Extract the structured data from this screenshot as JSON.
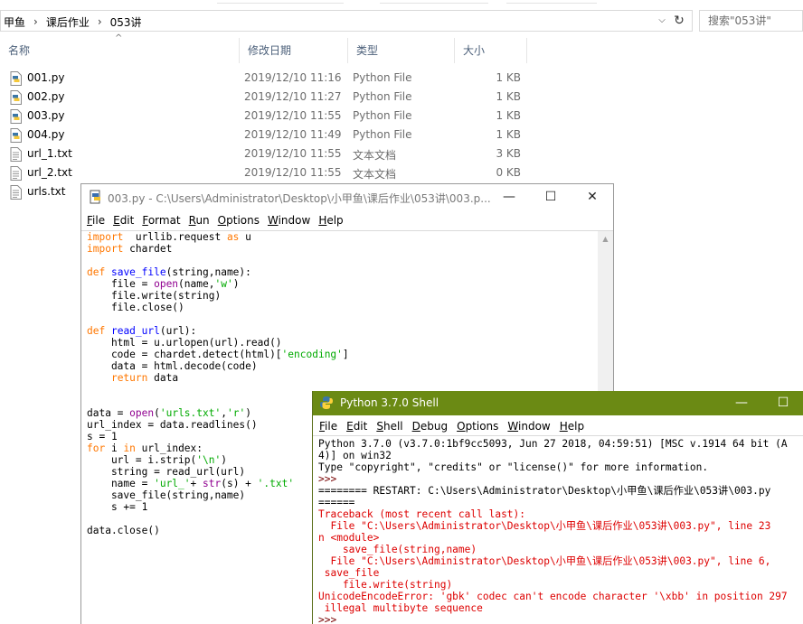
{
  "explorer": {
    "breadcrumbs": [
      "甲鱼",
      "课后作业",
      "053讲"
    ],
    "search_placeholder": "搜索\"053讲\"",
    "columns": {
      "name": "名称",
      "date": "修改日期",
      "type": "类型",
      "size": "大小"
    },
    "files": [
      {
        "name": "001.py",
        "date": "2019/12/10 11:16",
        "type": "Python File",
        "size": "1 KB",
        "icon": "python-file-icon"
      },
      {
        "name": "002.py",
        "date": "2019/12/10 11:27",
        "type": "Python File",
        "size": "1 KB",
        "icon": "python-file-icon"
      },
      {
        "name": "003.py",
        "date": "2019/12/10 11:55",
        "type": "Python File",
        "size": "1 KB",
        "icon": "python-file-icon"
      },
      {
        "name": "004.py",
        "date": "2019/12/10 11:49",
        "type": "Python File",
        "size": "1 KB",
        "icon": "python-file-icon"
      },
      {
        "name": "url_1.txt",
        "date": "2019/12/10 11:55",
        "type": "文本文档",
        "size": "3 KB",
        "icon": "text-file-icon"
      },
      {
        "name": "url_2.txt",
        "date": "2019/12/10 11:55",
        "type": "文本文档",
        "size": "0 KB",
        "icon": "text-file-icon"
      },
      {
        "name": "urls.txt",
        "date": "",
        "type": "",
        "size": "",
        "icon": "text-file-icon"
      }
    ]
  },
  "editor": {
    "title": "003.py - C:\\Users\\Administrator\\Desktop\\小甲鱼\\课后作业\\053讲\\003.p...",
    "menu": [
      "File",
      "Edit",
      "Format",
      "Run",
      "Options",
      "Window",
      "Help"
    ],
    "code_lines": [
      [
        [
          "kw",
          "import"
        ],
        [
          "",
          "  urllib.request "
        ],
        [
          "kw",
          "as"
        ],
        [
          "",
          " u"
        ]
      ],
      [
        [
          "kw",
          "import"
        ],
        [
          "",
          " chardet"
        ]
      ],
      [
        [
          "",
          ""
        ]
      ],
      [
        [
          "kw",
          "def"
        ],
        [
          "",
          " "
        ],
        [
          "df",
          "save_file"
        ],
        [
          "",
          "(string,name):"
        ]
      ],
      [
        [
          "",
          "    file = "
        ],
        [
          "bi",
          "open"
        ],
        [
          "",
          "(name,"
        ],
        [
          "st",
          "'w'"
        ],
        [
          "",
          ")"
        ]
      ],
      [
        [
          "",
          "    file.write(string)"
        ]
      ],
      [
        [
          "",
          "    file.close()"
        ]
      ],
      [
        [
          "",
          ""
        ]
      ],
      [
        [
          "kw",
          "def"
        ],
        [
          "",
          " "
        ],
        [
          "df",
          "read_url"
        ],
        [
          "",
          "(url):"
        ]
      ],
      [
        [
          "",
          "    html = u.urlopen(url).read()"
        ]
      ],
      [
        [
          "",
          "    code = chardet.detect(html)["
        ],
        [
          "st",
          "'encoding'"
        ],
        [
          "",
          "]"
        ]
      ],
      [
        [
          "",
          "    data = html.decode(code)"
        ]
      ],
      [
        [
          "",
          "    "
        ],
        [
          "kw",
          "return"
        ],
        [
          "",
          " data"
        ]
      ],
      [
        [
          "",
          ""
        ]
      ],
      [
        [
          "",
          ""
        ]
      ],
      [
        [
          "",
          "data = "
        ],
        [
          "bi",
          "open"
        ],
        [
          "",
          "("
        ],
        [
          "st",
          "'urls.txt'"
        ],
        [
          "",
          ","
        ],
        [
          "st",
          "'r'"
        ],
        [
          "",
          ")"
        ]
      ],
      [
        [
          "",
          "url_index = data.readlines()"
        ]
      ],
      [
        [
          "",
          "s = 1"
        ]
      ],
      [
        [
          "kw",
          "for"
        ],
        [
          "",
          " i "
        ],
        [
          "kw",
          "in"
        ],
        [
          "",
          " url_index:"
        ]
      ],
      [
        [
          "",
          "    url = i.strip("
        ],
        [
          "st",
          "'\\n'"
        ],
        [
          "",
          ")"
        ]
      ],
      [
        [
          "",
          "    string = read_url(url)"
        ]
      ],
      [
        [
          "",
          "    name = "
        ],
        [
          "st",
          "'url_'"
        ],
        [
          "",
          "+ "
        ],
        [
          "bi",
          "str"
        ],
        [
          "",
          "(s) + "
        ],
        [
          "st",
          "'.txt'"
        ]
      ],
      [
        [
          "",
          "    save_file(string,name)"
        ]
      ],
      [
        [
          "",
          "    s += 1"
        ]
      ],
      [
        [
          "",
          ""
        ]
      ],
      [
        [
          "",
          "data.close()"
        ]
      ]
    ]
  },
  "shell": {
    "title": "Python 3.7.0 Shell",
    "menu": [
      "File",
      "Edit",
      "Shell",
      "Debug",
      "Options",
      "Window",
      "Help"
    ],
    "lines": [
      [
        [
          "",
          "Python 3.7.0 (v3.7.0:1bf9cc5093, Jun 27 2018, 04:59:51) [MSC v.1914 64 bit (A"
        ]
      ],
      [
        [
          "",
          "4)] on win32"
        ]
      ],
      [
        [
          "",
          "Type \"copyright\", \"credits\" or \"license()\" for more information."
        ]
      ],
      [
        [
          "prompt",
          ">>> "
        ]
      ],
      [
        [
          "",
          "======== RESTART: C:\\Users\\Administrator\\Desktop\\小甲鱼\\课后作业\\053讲\\003.py"
        ]
      ],
      [
        [
          "",
          "======"
        ]
      ],
      [
        [
          "err",
          "Traceback (most recent call last):"
        ]
      ],
      [
        [
          "err",
          "  File \"C:\\Users\\Administrator\\Desktop\\小甲鱼\\课后作业\\053讲\\003.py\", line 23"
        ]
      ],
      [
        [
          "err",
          "n <module>"
        ]
      ],
      [
        [
          "err",
          "    save_file(string,name)"
        ]
      ],
      [
        [
          "err",
          "  File \"C:\\Users\\Administrator\\Desktop\\小甲鱼\\课后作业\\053讲\\003.py\", line 6,"
        ]
      ],
      [
        [
          "err",
          " save_file"
        ]
      ],
      [
        [
          "err",
          "    file.write(string)"
        ]
      ],
      [
        [
          "err",
          "UnicodeEncodeError: 'gbk' codec can't encode character '\\xbb' in position 297"
        ]
      ],
      [
        [
          "err",
          " illegal multibyte sequence"
        ]
      ],
      [
        [
          "prompt",
          ">>> "
        ]
      ]
    ]
  },
  "window_controls": {
    "minimize": "—",
    "maximize": "☐",
    "close": "✕"
  },
  "colors": {
    "shell_title_bg": "#6b8a14",
    "error": "#dd0000",
    "keyword": "#ff7700",
    "builtin": "#900090",
    "def_name": "#0000ff",
    "string": "#00aa00"
  }
}
